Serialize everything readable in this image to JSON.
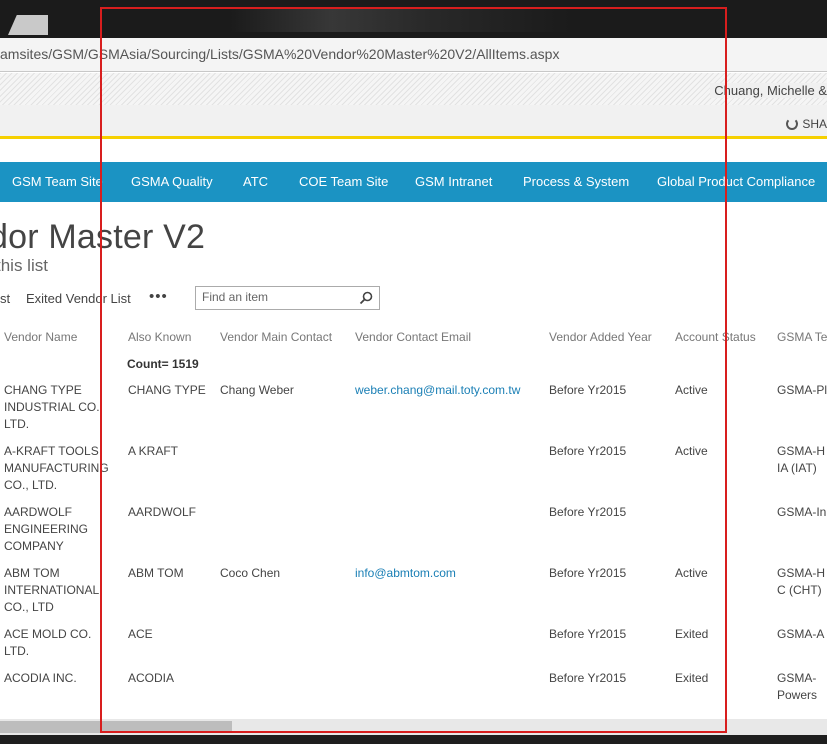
{
  "browser": {
    "address": "amsites/GSM/GSMAsia/Sourcing/Lists/GSMA%20Vendor%20Master%20V2/AllItems.aspx"
  },
  "suite": {
    "user_name": "Chuang, Michelle &",
    "share_label": "SHA"
  },
  "topnav": {
    "items": [
      "GSM Team Site",
      "GSMA Quality",
      "ATC",
      "COE Team Site",
      "GSM Intranet",
      "Process & System",
      "Global Product Compliance"
    ]
  },
  "page": {
    "title": "dor Master V2",
    "edit_link": "this list"
  },
  "views": {
    "items": [
      "st",
      "Exited Vendor List"
    ],
    "more": "•••"
  },
  "search": {
    "placeholder": "Find an item"
  },
  "list": {
    "columns": [
      "Vendor Name",
      "Also Known",
      "Vendor Main Contact",
      "Vendor Contact Email",
      "Vendor Added Year",
      "Account Status",
      "GSMA Te"
    ],
    "count_label": "Count= 1519",
    "rows": [
      {
        "name": "CHANG TYPE INDUSTRIAL CO., LTD.",
        "aka": "CHANG TYPE",
        "contact": "Chang Weber",
        "email": "weber.chang@mail.toty.com.tw",
        "year": "Before Yr2015",
        "status": "Active",
        "team": "GSMA-Pl"
      },
      {
        "name": "A-KRAFT TOOLS MANUFACTURING CO., LTD.",
        "aka": "A KRAFT",
        "contact": "",
        "email": "",
        "year": "Before Yr2015",
        "status": "Active",
        "team": "GSMA-H IA (IAT)"
      },
      {
        "name": "AARDWOLF ENGINEERING COMPANY",
        "aka": "AARDWOLF",
        "contact": "",
        "email": "",
        "year": "Before Yr2015",
        "status": "",
        "team": "GSMA-In"
      },
      {
        "name": "ABM TOM INTERNATIONAL CO., LTD",
        "aka": "ABM TOM",
        "contact": "Coco Chen",
        "email": "info@abmtom.com",
        "year": "Before Yr2015",
        "status": "Active",
        "team": "GSMA-H C (CHT)"
      },
      {
        "name": "ACE MOLD CO. LTD.",
        "aka": "ACE",
        "contact": "",
        "email": "",
        "year": "Before Yr2015",
        "status": "Exited",
        "team": "GSMA-A"
      },
      {
        "name": "ACODIA INC.",
        "aka": "ACODIA",
        "contact": "",
        "email": "",
        "year": "Before Yr2015",
        "status": "Exited",
        "team": "GSMA- Powers"
      }
    ]
  }
}
